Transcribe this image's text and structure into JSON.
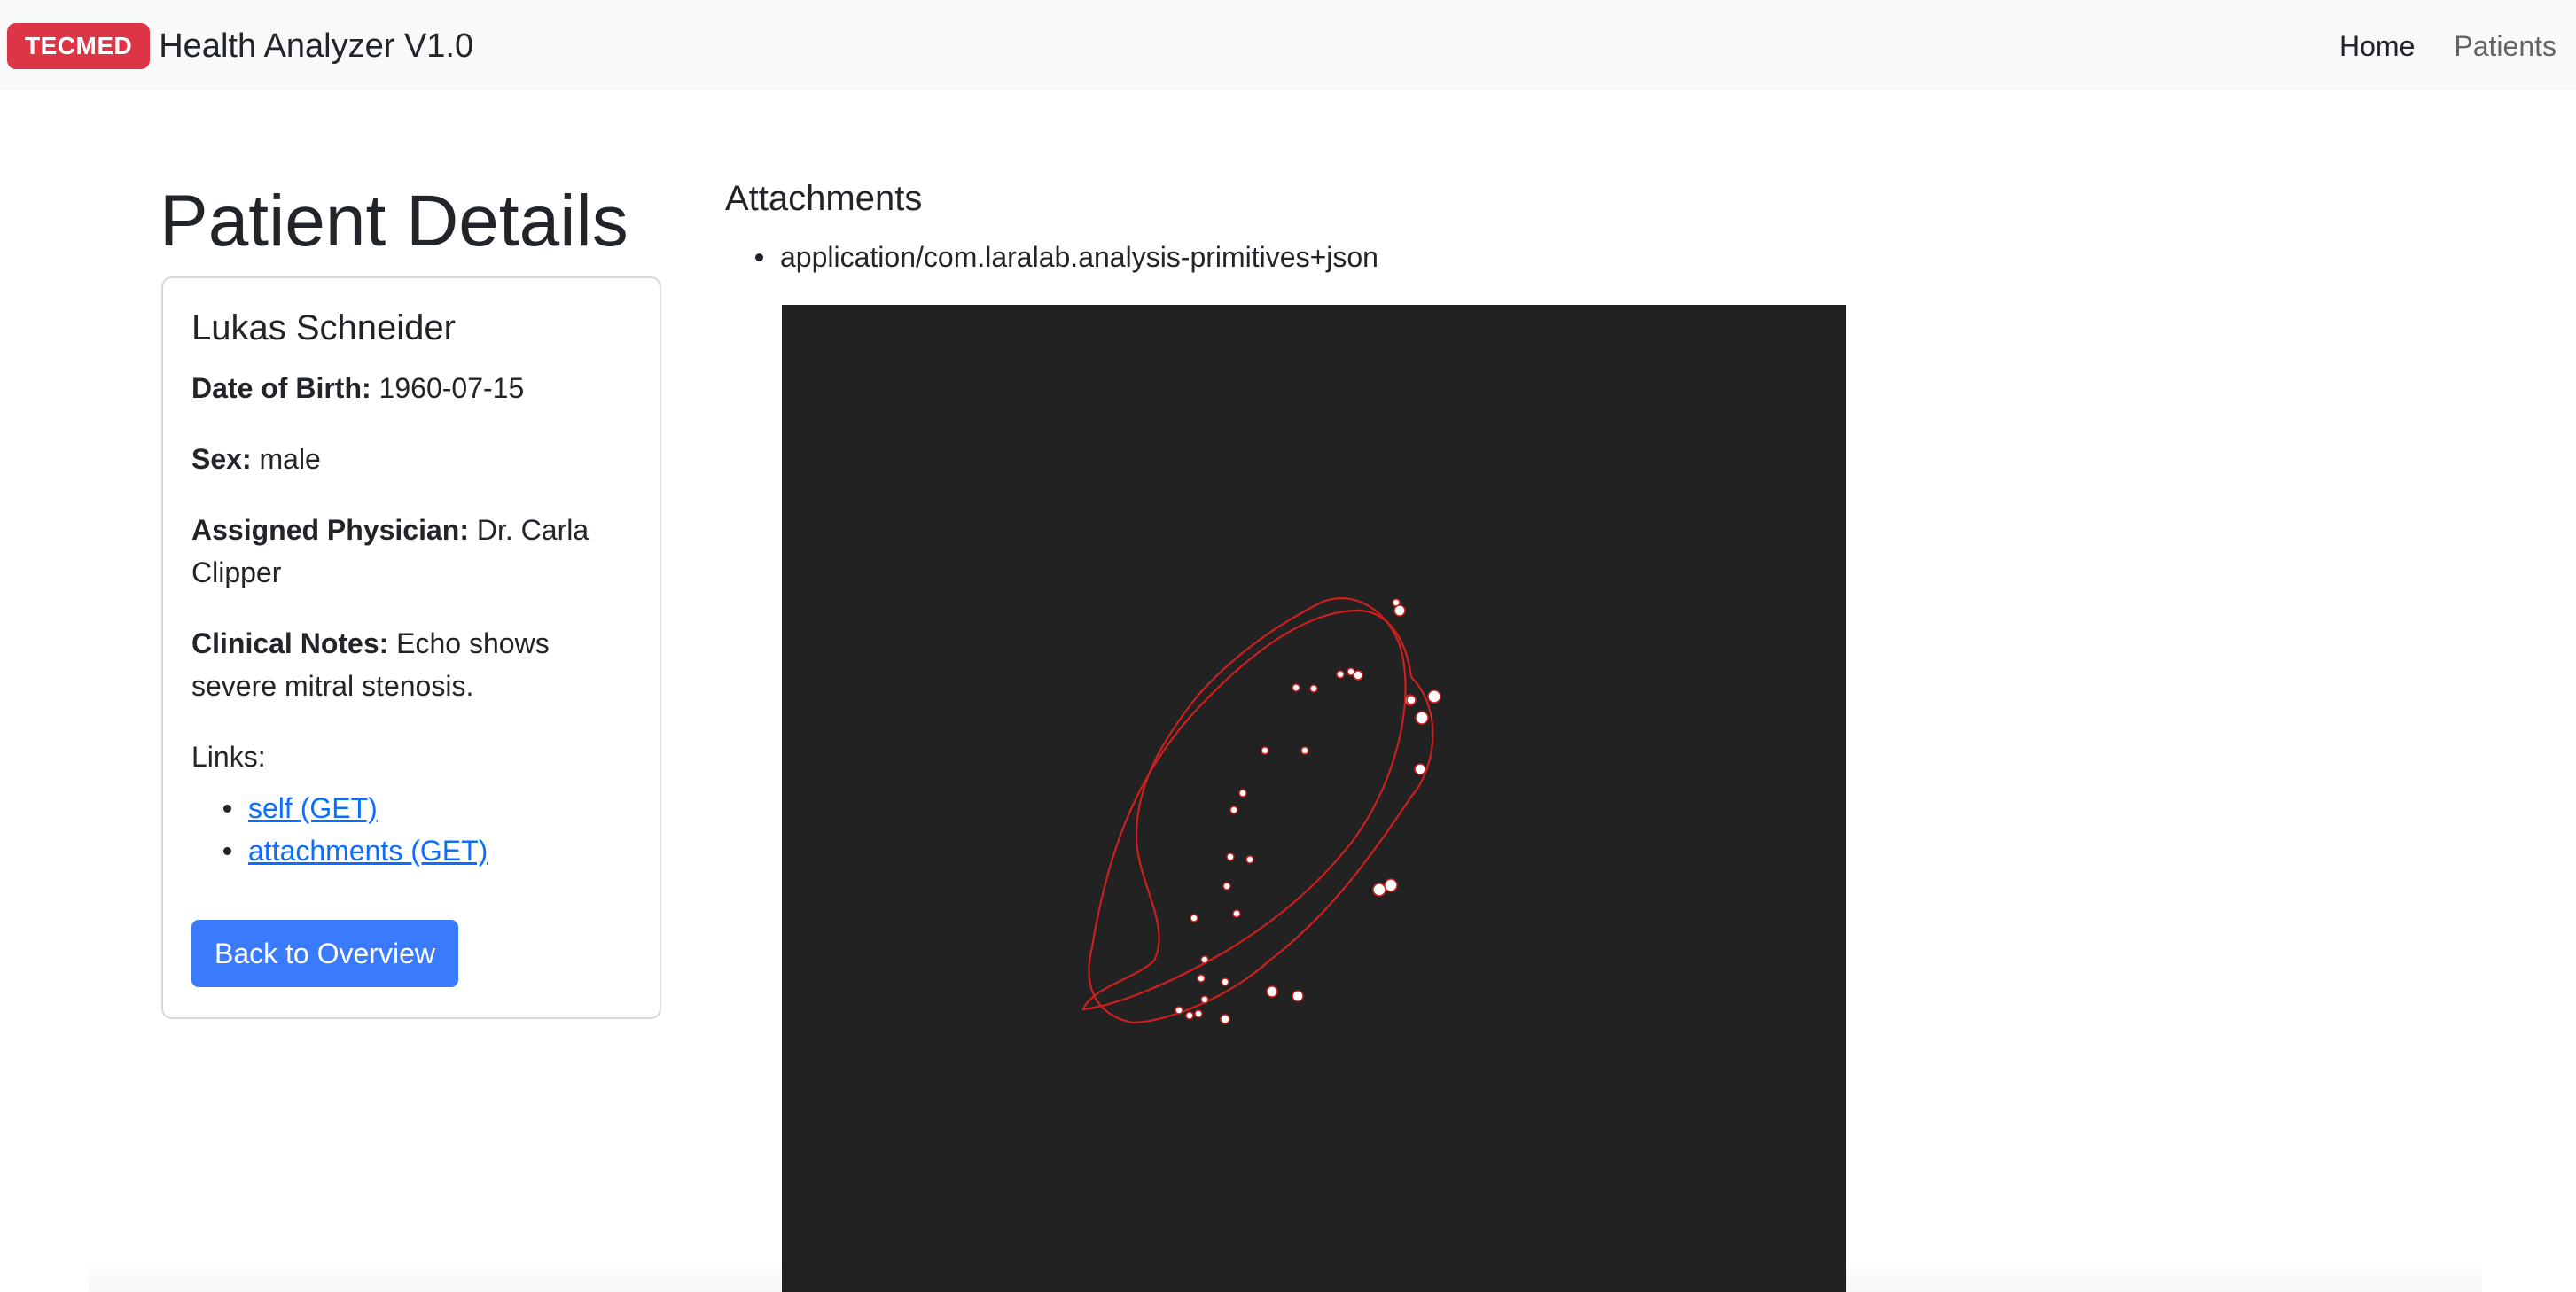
{
  "navbar": {
    "brand_badge": "TECMED",
    "brand_title": "Health Analyzer V1.0",
    "links": [
      {
        "label": "Home",
        "active": true
      },
      {
        "label": "Patients",
        "active": false
      }
    ]
  },
  "page_title": "Patient Details",
  "patient": {
    "name": "Lukas Schneider",
    "dob_label": "Date of Birth:",
    "dob_value": "1960-07-15",
    "sex_label": "Sex:",
    "sex_value": "male",
    "physician_label": "Assigned Physician:",
    "physician_value": "Dr. Carla Clipper",
    "notes_label": "Clinical Notes:",
    "notes_value": "Echo shows severe mitral stenosis.",
    "links_label": "Links:",
    "links": [
      {
        "label": "self (GET)"
      },
      {
        "label": "attachments (GET)"
      }
    ],
    "back_button": "Back to Overview"
  },
  "attachments": {
    "heading": "Attachments",
    "items": [
      "application/com.laralab.analysis-primitives+json"
    ]
  },
  "viewer": {
    "background": "#222222",
    "contour_color": "#cc1f1f",
    "point_color": "#ffffff"
  }
}
